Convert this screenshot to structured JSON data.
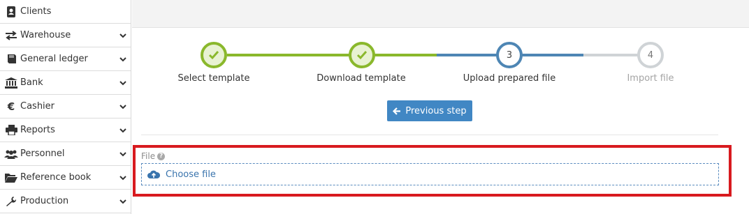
{
  "sidebar": {
    "items": [
      {
        "label": "Clients",
        "icon": "contact-book-icon",
        "has_chevron": false
      },
      {
        "label": "Warehouse",
        "icon": "exchange-arrows-icon",
        "has_chevron": true
      },
      {
        "label": "General ledger",
        "icon": "book-icon",
        "has_chevron": true
      },
      {
        "label": "Bank",
        "icon": "bank-icon",
        "has_chevron": true
      },
      {
        "label": "Cashier",
        "icon": "euro-icon",
        "has_chevron": true
      },
      {
        "label": "Reports",
        "icon": "printer-icon",
        "has_chevron": true
      },
      {
        "label": "Personnel",
        "icon": "users-icon",
        "has_chevron": true
      },
      {
        "label": "Reference book",
        "icon": "folder-open-icon",
        "has_chevron": true
      },
      {
        "label": "Production",
        "icon": "wrench-icon",
        "has_chevron": true
      }
    ]
  },
  "wizard": {
    "steps": [
      {
        "number": "1",
        "label": "Select template",
        "status": "done"
      },
      {
        "number": "2",
        "label": "Download template",
        "status": "done"
      },
      {
        "number": "3",
        "label": "Upload prepared file",
        "status": "active"
      },
      {
        "number": "4",
        "label": "Import file",
        "status": "todo"
      }
    ],
    "previous_button": "Previous step"
  },
  "file_field": {
    "label": "File",
    "choose_label": "Choose file"
  },
  "colors": {
    "done": "#8ab82c",
    "active": "#4e86b4",
    "todo": "#cfd3d6",
    "button": "#4187c4",
    "highlight": "#d81a1f"
  }
}
